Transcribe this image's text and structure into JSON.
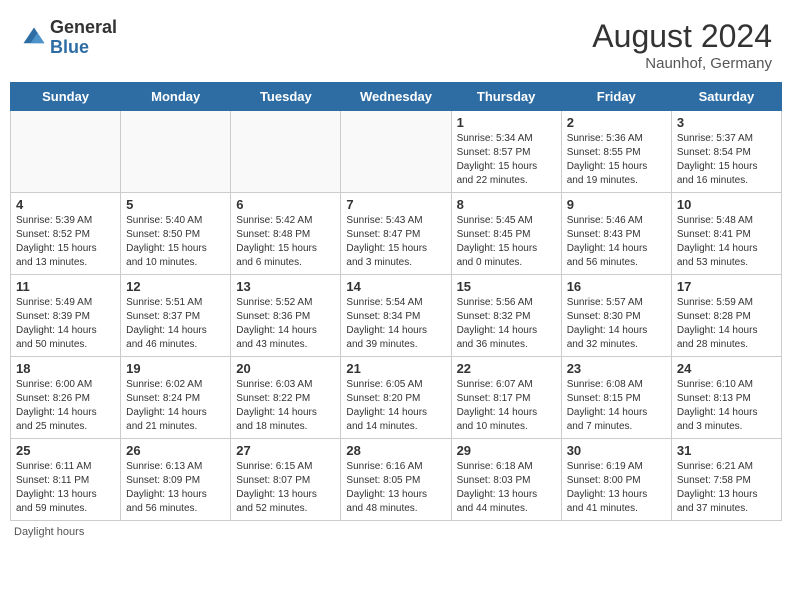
{
  "header": {
    "logo_general": "General",
    "logo_blue": "Blue",
    "month_year": "August 2024",
    "location": "Naunhof, Germany"
  },
  "days_of_week": [
    "Sunday",
    "Monday",
    "Tuesday",
    "Wednesday",
    "Thursday",
    "Friday",
    "Saturday"
  ],
  "weeks": [
    [
      {
        "day": "",
        "info": ""
      },
      {
        "day": "",
        "info": ""
      },
      {
        "day": "",
        "info": ""
      },
      {
        "day": "",
        "info": ""
      },
      {
        "day": "1",
        "info": "Sunrise: 5:34 AM\nSunset: 8:57 PM\nDaylight: 15 hours and 22 minutes."
      },
      {
        "day": "2",
        "info": "Sunrise: 5:36 AM\nSunset: 8:55 PM\nDaylight: 15 hours and 19 minutes."
      },
      {
        "day": "3",
        "info": "Sunrise: 5:37 AM\nSunset: 8:54 PM\nDaylight: 15 hours and 16 minutes."
      }
    ],
    [
      {
        "day": "4",
        "info": "Sunrise: 5:39 AM\nSunset: 8:52 PM\nDaylight: 15 hours and 13 minutes."
      },
      {
        "day": "5",
        "info": "Sunrise: 5:40 AM\nSunset: 8:50 PM\nDaylight: 15 hours and 10 minutes."
      },
      {
        "day": "6",
        "info": "Sunrise: 5:42 AM\nSunset: 8:48 PM\nDaylight: 15 hours and 6 minutes."
      },
      {
        "day": "7",
        "info": "Sunrise: 5:43 AM\nSunset: 8:47 PM\nDaylight: 15 hours and 3 minutes."
      },
      {
        "day": "8",
        "info": "Sunrise: 5:45 AM\nSunset: 8:45 PM\nDaylight: 15 hours and 0 minutes."
      },
      {
        "day": "9",
        "info": "Sunrise: 5:46 AM\nSunset: 8:43 PM\nDaylight: 14 hours and 56 minutes."
      },
      {
        "day": "10",
        "info": "Sunrise: 5:48 AM\nSunset: 8:41 PM\nDaylight: 14 hours and 53 minutes."
      }
    ],
    [
      {
        "day": "11",
        "info": "Sunrise: 5:49 AM\nSunset: 8:39 PM\nDaylight: 14 hours and 50 minutes."
      },
      {
        "day": "12",
        "info": "Sunrise: 5:51 AM\nSunset: 8:37 PM\nDaylight: 14 hours and 46 minutes."
      },
      {
        "day": "13",
        "info": "Sunrise: 5:52 AM\nSunset: 8:36 PM\nDaylight: 14 hours and 43 minutes."
      },
      {
        "day": "14",
        "info": "Sunrise: 5:54 AM\nSunset: 8:34 PM\nDaylight: 14 hours and 39 minutes."
      },
      {
        "day": "15",
        "info": "Sunrise: 5:56 AM\nSunset: 8:32 PM\nDaylight: 14 hours and 36 minutes."
      },
      {
        "day": "16",
        "info": "Sunrise: 5:57 AM\nSunset: 8:30 PM\nDaylight: 14 hours and 32 minutes."
      },
      {
        "day": "17",
        "info": "Sunrise: 5:59 AM\nSunset: 8:28 PM\nDaylight: 14 hours and 28 minutes."
      }
    ],
    [
      {
        "day": "18",
        "info": "Sunrise: 6:00 AM\nSunset: 8:26 PM\nDaylight: 14 hours and 25 minutes."
      },
      {
        "day": "19",
        "info": "Sunrise: 6:02 AM\nSunset: 8:24 PM\nDaylight: 14 hours and 21 minutes."
      },
      {
        "day": "20",
        "info": "Sunrise: 6:03 AM\nSunset: 8:22 PM\nDaylight: 14 hours and 18 minutes."
      },
      {
        "day": "21",
        "info": "Sunrise: 6:05 AM\nSunset: 8:20 PM\nDaylight: 14 hours and 14 minutes."
      },
      {
        "day": "22",
        "info": "Sunrise: 6:07 AM\nSunset: 8:17 PM\nDaylight: 14 hours and 10 minutes."
      },
      {
        "day": "23",
        "info": "Sunrise: 6:08 AM\nSunset: 8:15 PM\nDaylight: 14 hours and 7 minutes."
      },
      {
        "day": "24",
        "info": "Sunrise: 6:10 AM\nSunset: 8:13 PM\nDaylight: 14 hours and 3 minutes."
      }
    ],
    [
      {
        "day": "25",
        "info": "Sunrise: 6:11 AM\nSunset: 8:11 PM\nDaylight: 13 hours and 59 minutes."
      },
      {
        "day": "26",
        "info": "Sunrise: 6:13 AM\nSunset: 8:09 PM\nDaylight: 13 hours and 56 minutes."
      },
      {
        "day": "27",
        "info": "Sunrise: 6:15 AM\nSunset: 8:07 PM\nDaylight: 13 hours and 52 minutes."
      },
      {
        "day": "28",
        "info": "Sunrise: 6:16 AM\nSunset: 8:05 PM\nDaylight: 13 hours and 48 minutes."
      },
      {
        "day": "29",
        "info": "Sunrise: 6:18 AM\nSunset: 8:03 PM\nDaylight: 13 hours and 44 minutes."
      },
      {
        "day": "30",
        "info": "Sunrise: 6:19 AM\nSunset: 8:00 PM\nDaylight: 13 hours and 41 minutes."
      },
      {
        "day": "31",
        "info": "Sunrise: 6:21 AM\nSunset: 7:58 PM\nDaylight: 13 hours and 37 minutes."
      }
    ]
  ],
  "footer": "Daylight hours"
}
